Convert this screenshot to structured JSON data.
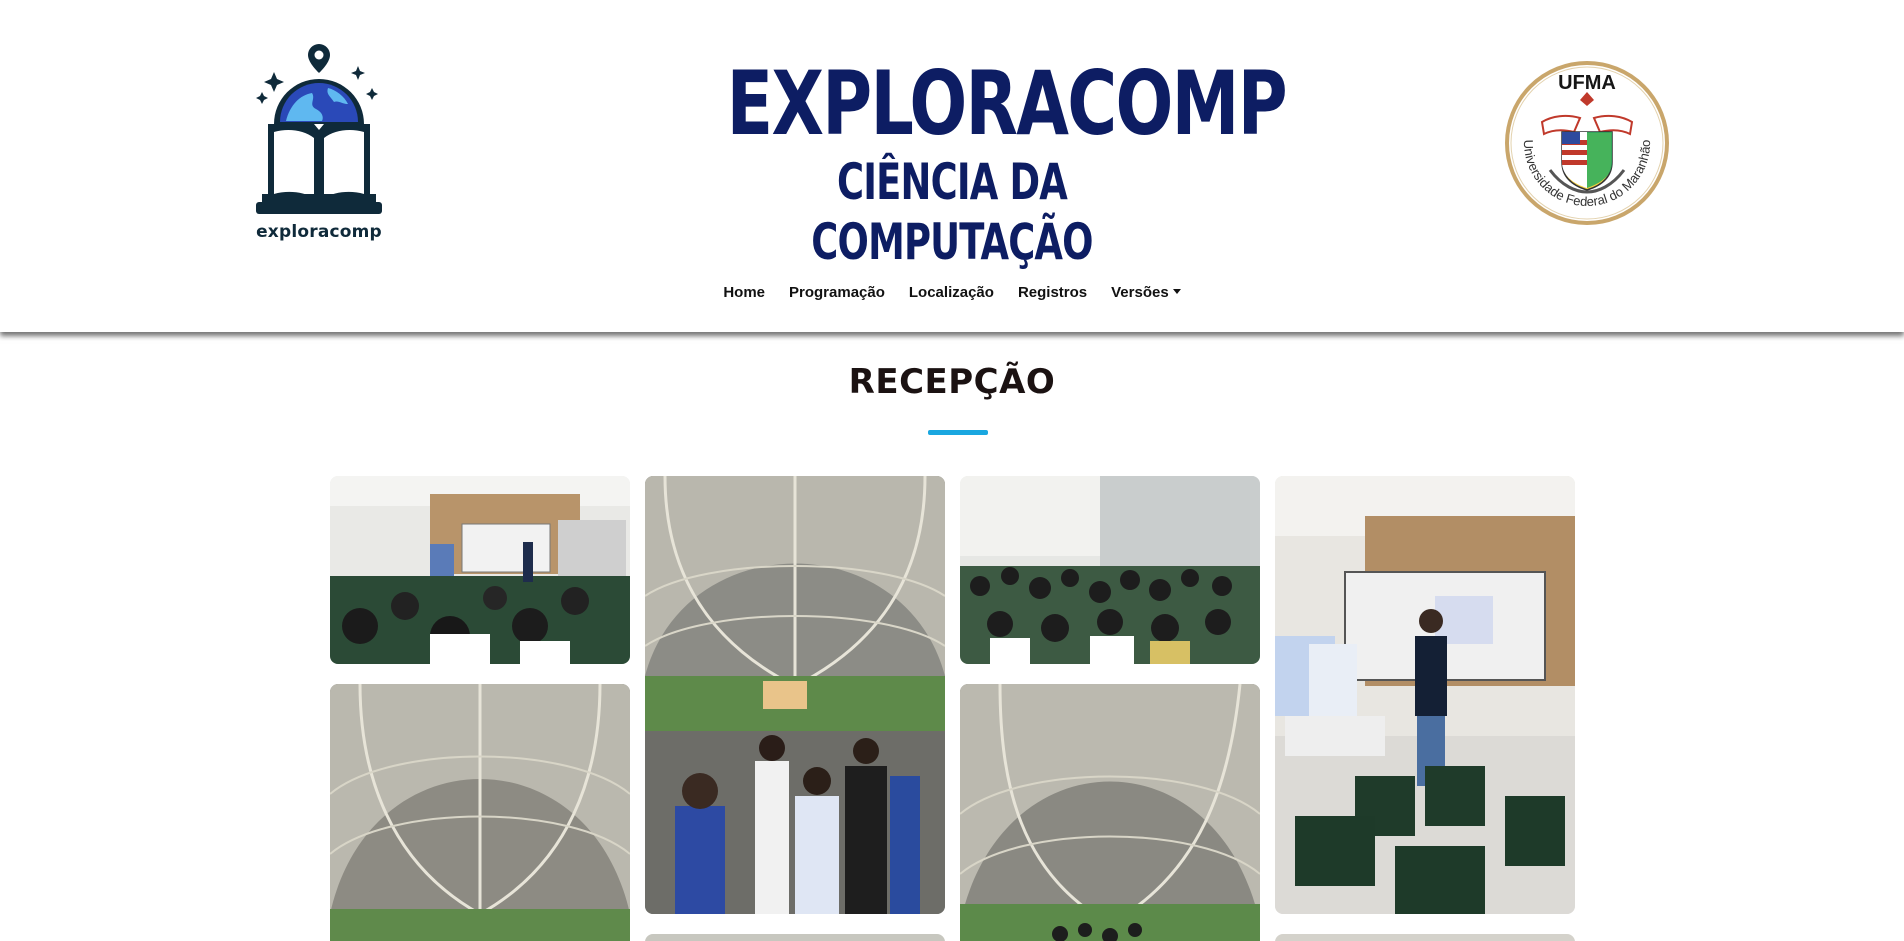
{
  "header": {
    "left_logo": {
      "icon": "globe-book-icon",
      "text": "exploracomp"
    },
    "title": "EXPLORACOMP",
    "subtitle": "CIÊNCIA DA COMPUTAÇÃO",
    "right_logo": {
      "icon": "ufma-seal-icon",
      "text": "UFMA",
      "ring_text": "Universidade Federal do Maranhão"
    }
  },
  "nav": {
    "items": [
      {
        "label": "Home"
      },
      {
        "label": "Programação"
      },
      {
        "label": "Localização"
      },
      {
        "label": "Registros"
      },
      {
        "label": "Versões",
        "dropdown": true
      }
    ]
  },
  "section": {
    "title": "RECEPÇÃO"
  },
  "colors": {
    "brand_navy": "#0d1d63",
    "accent": "#1aa7e0",
    "text": "#111111"
  },
  "gallery": {
    "photos": [
      {
        "subject": "auditorium-students-front-view"
      },
      {
        "subject": "students-under-covered-walkway-with-sign"
      },
      {
        "subject": "auditorium-students-seated"
      },
      {
        "subject": "speaker-presenting-in-classroom"
      },
      {
        "subject": "covered-walkway-roof"
      },
      {
        "subject": "covered-walkway-roof-with-group"
      }
    ]
  }
}
